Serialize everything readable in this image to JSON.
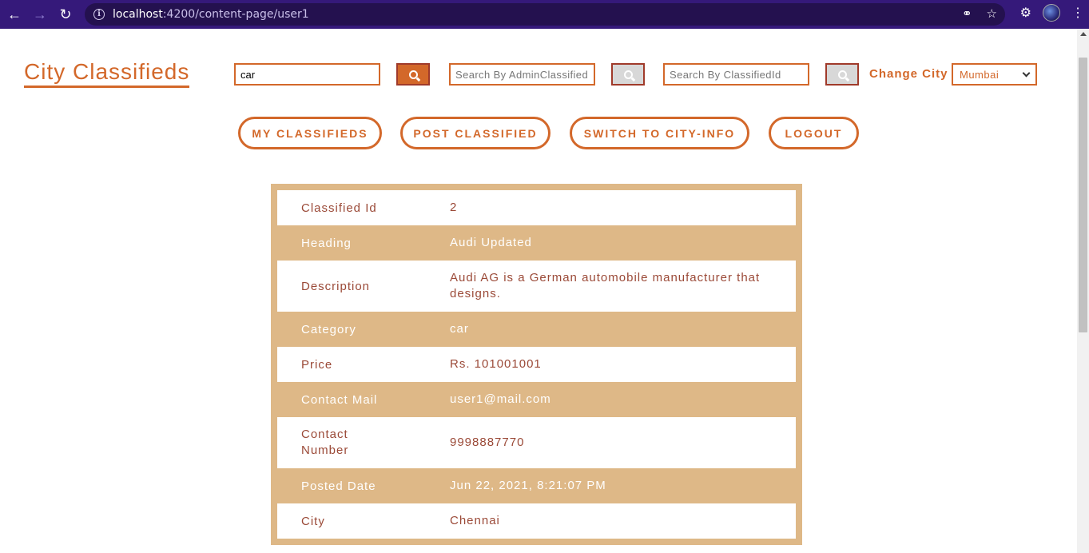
{
  "browser": {
    "url_host": "localhost",
    "url_rest": ":4200/content-page/user1"
  },
  "header": {
    "brand": "City Classifieds",
    "search_value": "car",
    "admin_search_placeholder": "Search By AdminClassifiedId",
    "classified_search_placeholder": "Search By ClassifiedId",
    "change_city_label": "Change City",
    "selected_city": "Mumbai"
  },
  "nav": {
    "my_classifieds": "MY CLASSIFIEDS",
    "post_classified": "POST CLASSIFIED",
    "switch_city_info": "SWITCH TO CITY-INFO",
    "logout": "LOGOUT"
  },
  "details": [
    {
      "label": "Classified Id",
      "value": "2"
    },
    {
      "label": "Heading",
      "value": "Audi Updated"
    },
    {
      "label": "Description",
      "value": "Audi AG is a German automobile manufacturer that designs."
    },
    {
      "label": "Category",
      "value": "car"
    },
    {
      "label": "Price",
      "value": "Rs. 101001001"
    },
    {
      "label": "Contact Mail",
      "value": "user1@mail.com"
    },
    {
      "label": "Contact Number",
      "value": "9998887770"
    },
    {
      "label": "Posted Date",
      "value": "Jun 22, 2021, 8:21:07 PM"
    },
    {
      "label": "City",
      "value": "Chennai"
    }
  ],
  "colors": {
    "accent": "#d3682a",
    "table_bg": "#deb887",
    "text_dark": "#9b4a38",
    "chrome": "#35197a"
  }
}
